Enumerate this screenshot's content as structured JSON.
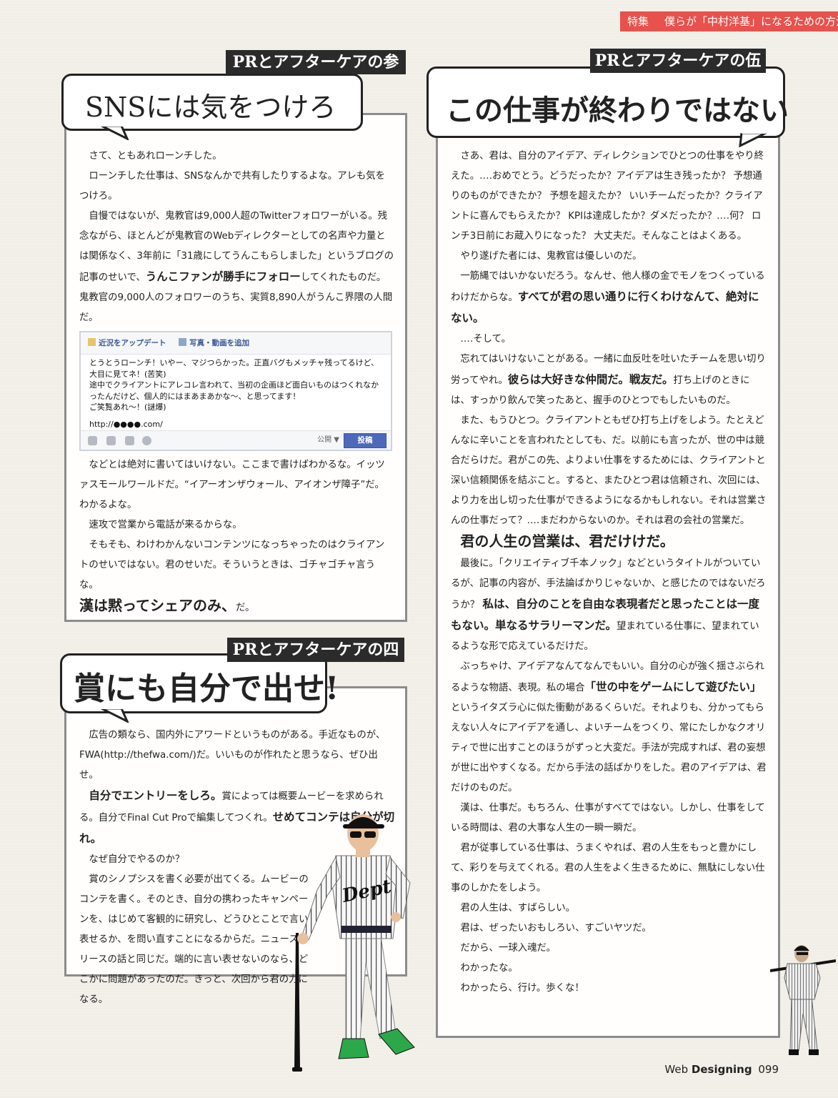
{
  "header": {
    "label": "特集",
    "title": "僕らが「中村洋基」になるための方法"
  },
  "sec3": {
    "ribbon": "PRとアフターケアの参",
    "title": "SNSには気をつけろ",
    "paras": [
      "さて、ともあれローンチした。",
      "ローンチした仕事は、SNSなんかで共有したりするよな。アレも気をつけろ。",
      "自慢ではないが、鬼教官は9,000人超のTwitterフォロワーがいる。残念ながら、ほとんどが鬼教官のWebディレクターとしての名声や力量とは関係なく、3年前に「31歳にしてうんこもらしました」というブログの記事のせいで、",
      "うんこファンが勝手にフォロー",
      "してくれたものだ。鬼教官の9,000人のフォロワーのうち、実質8,890人がうんこ界隈の人間だ。",
      "などとは絶対に書いてはいけない。ここまで書けばわかるな。イッツァスモールワールドだ。“イアーオンザウォール、アイオンザ障子”だ。わかるよな。",
      "速攻で営業から電話が来るからな。",
      "そもそも、わけわかんないコンテンツになっちゃったのはクライアントのせいではない。君のせいだ。そういうときは、ゴチャゴチャ言うな。",
      "漢は黙ってシェアのみ、",
      "だ。"
    ],
    "fb": {
      "tab1": "近況をアップデート",
      "tab2": "写真・動画を追加",
      "line1": "とうとうローンチ！いやー、マジつらかった。正直バグもメッチャ残ってるけど、大目に見てネ！(苦笑)",
      "line2": "途中でクライアントにアレコレ言われて、当初の企画ほど面白いものはつくれなかったんだけど、個人的にはまあまあかな〜、と思ってます！",
      "line3": "ご笑覧あれ〜！(謎爆)",
      "url": "http://●●●●.com/",
      "public": "公開 ▼",
      "post": "投稿"
    }
  },
  "sec4": {
    "ribbon": "PRとアフターケアの四",
    "title": "賞にも自分で出せ!",
    "p1": "広告の類なら、国内外にアワードというものがある。手近なものが、FWA(http://thefwa.com/)だ。いいものが作れたと思うなら、ぜひ出せ。",
    "b1": "自分でエントリーをしろ。",
    "p2a": "賞によっては概要ムービーを求められる。自分でFinal Cut Proで編集してつくれ。",
    "b2": "せめてコンテは自分が切れ。",
    "p3": "なぜ自分でやるのか？",
    "p4": "賞のシノプシスを書く必要が出てくる。ムービーのコンテを書く。そのとき、自分の携わったキャンペーンを、はじめて客観的に研究し、どうひとことで言い表せるか、を問い直すことになるからだ。ニュースリリースの話と同じだ。端的に言い表せないのなら、どこかに問題があったのだ。きっと、次回から君の力になる。"
  },
  "sec5": {
    "ribbon": "PRとアフターケアの伍",
    "title": "この仕事が終わりではない",
    "p1": "さあ、君は、自分のアイデア、ディレクションでひとつの仕事をやり終えた。‥‥おめでとう。どうだったか？アイデアは生き残ったか？ 予想通りのものができたか？ 予想を超えたか？ いいチームだったか？クライアントに喜んでもらえたか？ KPIは達成したか？ダメだったか？‥‥何？ ロンチ3日前にお蔵入りになった？ 大丈夫だ。そんなことはよくある。",
    "p2": "やり遂げた者には、鬼教官は優しいのだ。",
    "p3a": "一筋縄ではいかないだろう。なんせ、他人様の金でモノをつくっているわけだからな。",
    "b3": "すべてが君の思い通りに行くわけなんて、絶対にない。",
    "p4": "‥‥そして。",
    "p5a": "忘れてはいけないことがある。一緒に血反吐を吐いたチームを思い切り労ってやれ。",
    "b5": "彼らは大好きな仲間だ。戦友だ。",
    "p5b": "打ち上げのときには、すっかり飲んで笑ったあと、握手のひとつでもしたいものだ。",
    "p6": "また、もうひとつ。クライアントともぜひ打ち上げをしよう。たとえどんなに辛いことを言われたとしても、だ。以前にも言ったが、世の中は競合だらけだ。君がこの先、よりよい仕事をするためには、クライアントと深い信頼関係を結ぶこと。すると、またひとつ君は信頼され、次回には、より力を出し切った仕事ができるようになるかもしれない。それは営業さんの仕事だって？‥‥まだわからないのか。それは君の会社の営業だ。",
    "big": "君の人生の営業は、君だけけだ。",
    "p7a": "最後に。「クリエイティブ千本ノック」などというタイトルがついているが、記事の内容が、手法論ばかりじゃないか、と感じたのではないだろうか？ ",
    "b7": "私は、自分のことを自由な表現者だと思ったことは一度もない。単なるサラリーマンだ。",
    "p7b": "望まれている仕事に、望まれているような形で応えているだけだ。",
    "p8a": "ぶっちゃけ、アイデアなんてなんでもいい。自分の心が強く揺さぶられるような物語、表現。私の場合",
    "b8": "「世の中をゲームにして遊びたい」",
    "p8b": "というイタズラ心に似た衝動があるくらいだ。それよりも、分かってもらえない人々にアイデアを通し、よいチームをつくり、常にたしかなクオリティで世に出すことのほうがずっと大変だ。手法が完成すれば、君の妄想が世に出やすくなる。だから手法の話ばかりをした。君のアイデアは、君だけのものだ。",
    "p9": "漢は、仕事だ。もちろん、仕事がすべてではない。しかし、仕事をしている時間は、君の大事な人生の一瞬一瞬だ。",
    "p10": "君が従事している仕事は、うまくやれば、君の人生をもっと豊かにして、彩りを与えてくれる。君の人生をよく生きるために、無駄にしない仕事のしかたをしよう。",
    "p11": "君の人生は、すばらしい。",
    "p12": "君は、ぜったいおもしろい、すごいヤツだ。",
    "p13": "だから、一球入魂だ。",
    "p14": "わかったな。",
    "p15": "わかったら、行け。歩くな！"
  },
  "jersey_text": "Dept",
  "footer": {
    "brand_light": "Web ",
    "brand_bold": "Designing",
    "page": "099"
  }
}
